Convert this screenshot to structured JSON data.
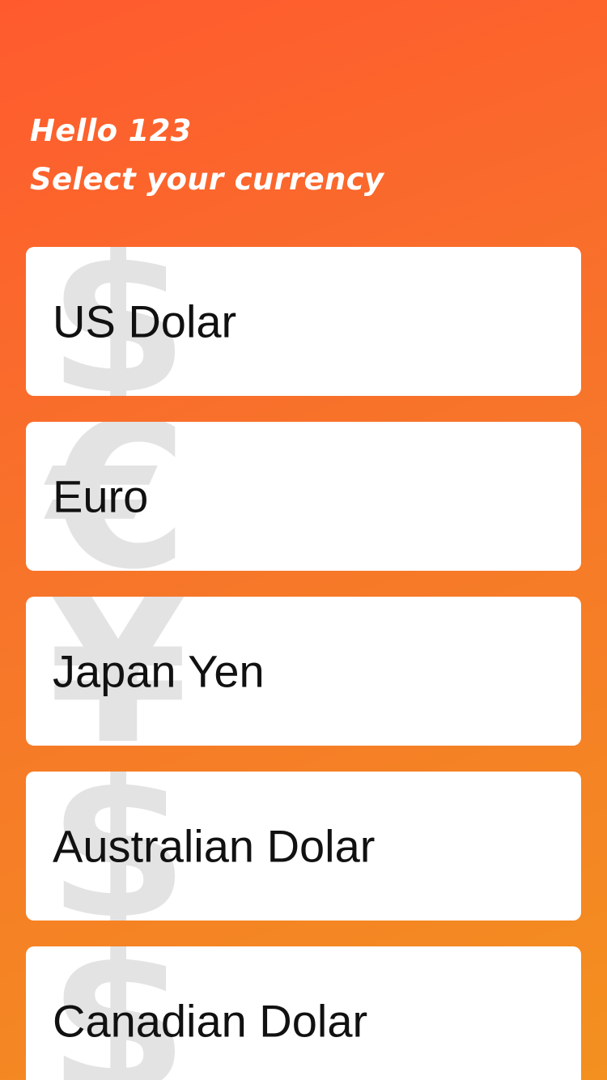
{
  "header": {
    "greeting": "Hello 123",
    "subtitle": "Select your currency"
  },
  "colors": {
    "gradient_start": "#ff5a2e",
    "gradient_end": "#f3901f",
    "card": "#ffffff",
    "watermark": "#e3e3e3",
    "text": "#111111"
  },
  "currencies": [
    {
      "label": "US Dolar",
      "icon": "dollar-icon",
      "symbol": "$"
    },
    {
      "label": "Euro",
      "icon": "euro-icon",
      "symbol": "€"
    },
    {
      "label": "Japan Yen",
      "icon": "yen-icon",
      "symbol": "¥"
    },
    {
      "label": "Australian Dolar",
      "icon": "dollar-icon",
      "symbol": "$"
    },
    {
      "label": "Canadian Dolar",
      "icon": "dollar-icon",
      "symbol": "$"
    }
  ]
}
